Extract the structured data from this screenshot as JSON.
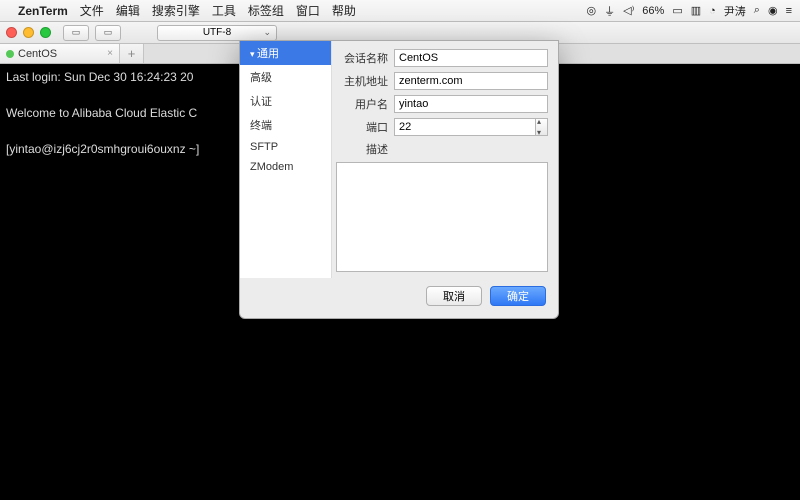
{
  "menubar": {
    "app": "ZenTerm",
    "items": [
      "文件",
      "编辑",
      "搜索引擎",
      "工具",
      "标签组",
      "窗口",
      "帮助"
    ],
    "right": {
      "battery": "66%",
      "user": "尹涛"
    }
  },
  "toolbar": {
    "encoding": "UTF-8"
  },
  "tabs": {
    "active": "CentOS"
  },
  "terminal": {
    "line1": "Last login: Sun Dec 30 16:24:23 20",
    "line2": "",
    "line3": "Welcome to Alibaba Cloud Elastic C",
    "line4": "",
    "line5": "[yintao@izj6cj2r0smhgroui6ouxnz ~]"
  },
  "dialog": {
    "sidebar": [
      "通用",
      "高级",
      "认证",
      "终端",
      "SFTP",
      "ZModem"
    ],
    "labels": {
      "session": "会话名称",
      "host": "主机地址",
      "user": "用户名",
      "port": "端口",
      "desc": "描述"
    },
    "values": {
      "session": "CentOS",
      "host": "zenterm.com",
      "user": "yintao",
      "port": "22"
    },
    "buttons": {
      "cancel": "取消",
      "ok": "确定"
    }
  }
}
